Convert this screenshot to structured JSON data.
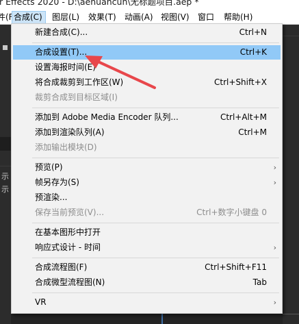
{
  "window": {
    "title": "r Effects 2020 - D:\\aehuancun\\无标题项目.aep *"
  },
  "menubar": {
    "items": [
      {
        "label": "件(F)"
      },
      {
        "label": "合成(C)"
      },
      {
        "label": "图层(L)"
      },
      {
        "label": "效果(T)"
      },
      {
        "label": "动画(A)"
      },
      {
        "label": "视图(V)"
      },
      {
        "label": "窗口"
      },
      {
        "label": "帮助(H)"
      }
    ]
  },
  "background": {
    "left_text_1": "示",
    "left_text_2": "示"
  },
  "dropdown": {
    "items": [
      {
        "label": "新建合成(C)...",
        "shortcut": "Ctrl+N"
      },
      {
        "label": "合成设置(T)...",
        "shortcut": "Ctrl+K"
      },
      {
        "label": "设置海报时间(E)",
        "shortcut": ""
      },
      {
        "label": "将合成裁剪到工作区(W)",
        "shortcut": "Ctrl+Shift+X"
      },
      {
        "label": "裁剪合成到目标区域(I)",
        "shortcut": ""
      },
      {
        "label": "添加到 Adobe Media Encoder 队列...",
        "shortcut": "Ctrl+Alt+M"
      },
      {
        "label": "添加到渲染队列(A)",
        "shortcut": "Ctrl+M"
      },
      {
        "label": "添加输出模块(D)",
        "shortcut": ""
      },
      {
        "label": "预览(P)",
        "shortcut": ""
      },
      {
        "label": "帧另存为(S)",
        "shortcut": ""
      },
      {
        "label": "预渲染...",
        "shortcut": ""
      },
      {
        "label": "保存当前预览(V)...",
        "shortcut": "Ctrl+数字小键盘 0"
      },
      {
        "label": "在基本图形中打开",
        "shortcut": ""
      },
      {
        "label": "响应式设计 - 时间",
        "shortcut": ""
      },
      {
        "label": "合成流程图(F)",
        "shortcut": "Ctrl+Shift+F11"
      },
      {
        "label": "合成微型流程图(N)",
        "shortcut": "Tab"
      },
      {
        "label": "VR",
        "shortcut": ""
      }
    ],
    "submenu_arrow": "›"
  },
  "colors": {
    "highlight": "#91c9f7",
    "annotation_arrow": "#e8474b",
    "menu_bg": "#f2f2f2"
  }
}
